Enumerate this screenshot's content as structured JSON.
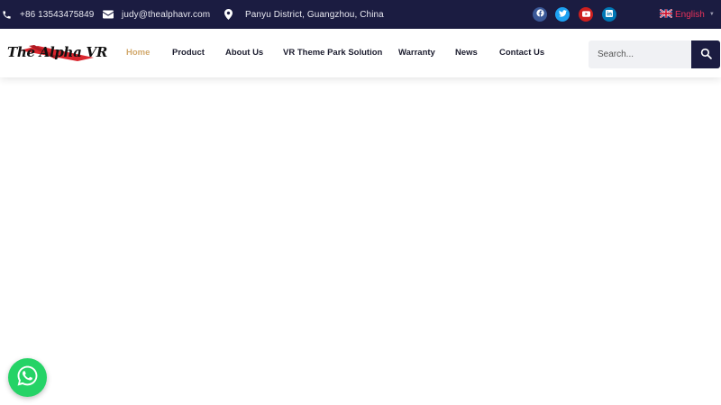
{
  "topbar": {
    "phone": "+86 13543475849",
    "email": "judy@thealphavr.com",
    "address": "Panyu District, Guangzhou, China",
    "social": [
      {
        "icon": "facebook-icon",
        "color": "#3b5998"
      },
      {
        "icon": "twitter-icon",
        "color": "#1da1f2"
      },
      {
        "icon": "youtube-icon",
        "color": "#cd201f"
      },
      {
        "icon": "linkedin-icon",
        "color": "#0077b5"
      }
    ],
    "language": "English"
  },
  "header": {
    "logo_text": "The Alpha VR",
    "nav": [
      {
        "label": "Home",
        "active": true
      },
      {
        "label": "Product",
        "active": false
      },
      {
        "label": "About Us",
        "active": false
      },
      {
        "label": "VR Theme Park Solution",
        "active": false
      },
      {
        "label": "Warranty",
        "active": false
      },
      {
        "label": "News",
        "active": false
      },
      {
        "label": "Contact Us",
        "active": false
      }
    ],
    "search": {
      "placeholder": "Search..."
    }
  },
  "colors": {
    "topbar_bg": "#1b1c41",
    "nav_active": "#d2a96c",
    "whatsapp": "#25d366",
    "language_text": "#e8325a"
  }
}
